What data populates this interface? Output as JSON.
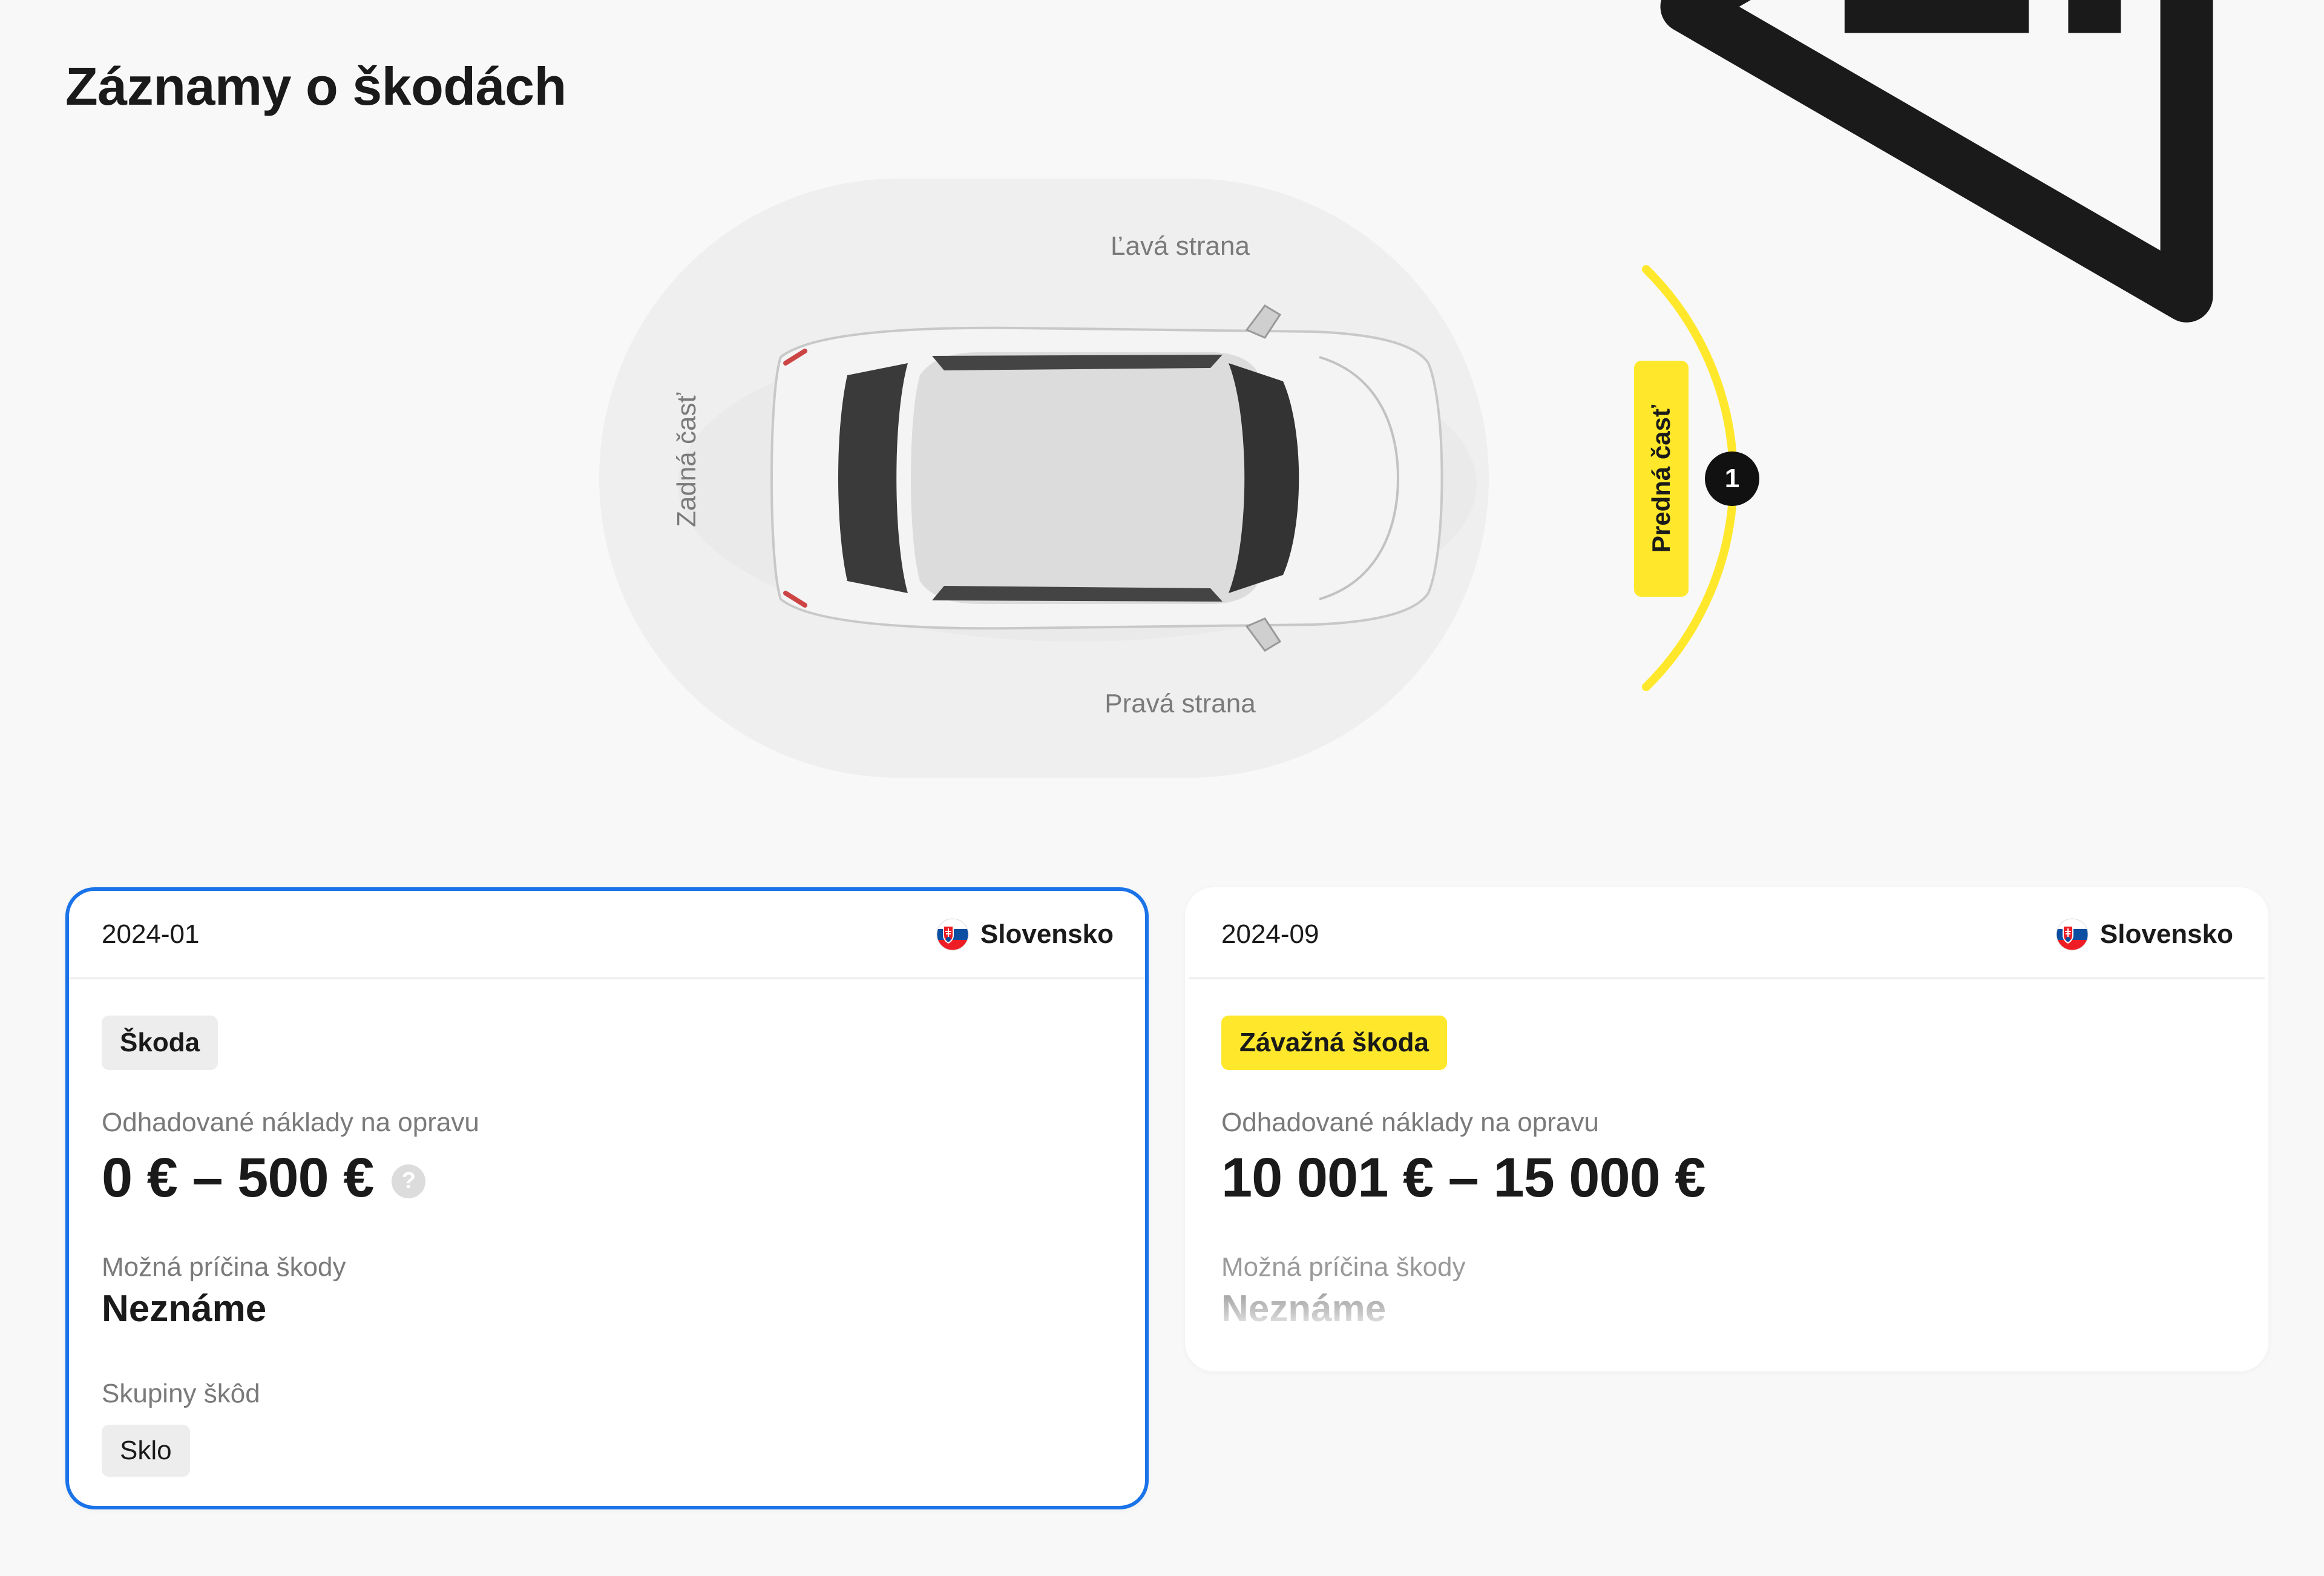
{
  "page": {
    "title": "Záznamy o škodách"
  },
  "diagram": {
    "left_side_label": "Ľavá strana",
    "right_side_label": "Pravá strana",
    "rear_label": "Zadná časť",
    "front_label": "Predná časť",
    "front_marker_count": "1",
    "highlight_color": "#ffe82b"
  },
  "records": [
    {
      "date": "2024-01",
      "country": "Slovensko",
      "badge": "Škoda",
      "cost_label": "Odhadované náklady na opravu",
      "cost_value": "0 € – 500 €",
      "help_icon": "?",
      "cause_label": "Možná príčina škody",
      "cause_value": "Neznáme",
      "groups_label": "Skupiny škôd",
      "groups": [
        "Sklo"
      ],
      "selected": true,
      "border_color": "#1a73e8"
    },
    {
      "date": "2024-09",
      "country": "Slovensko",
      "badge": "Závažná škoda",
      "cost_label": "Odhadované náklady na opravu",
      "cost_value": "10 001 € – 15 000 €",
      "cause_label": "Možná príčina škody",
      "cause_value": "Neznáme",
      "selected": false
    }
  ]
}
